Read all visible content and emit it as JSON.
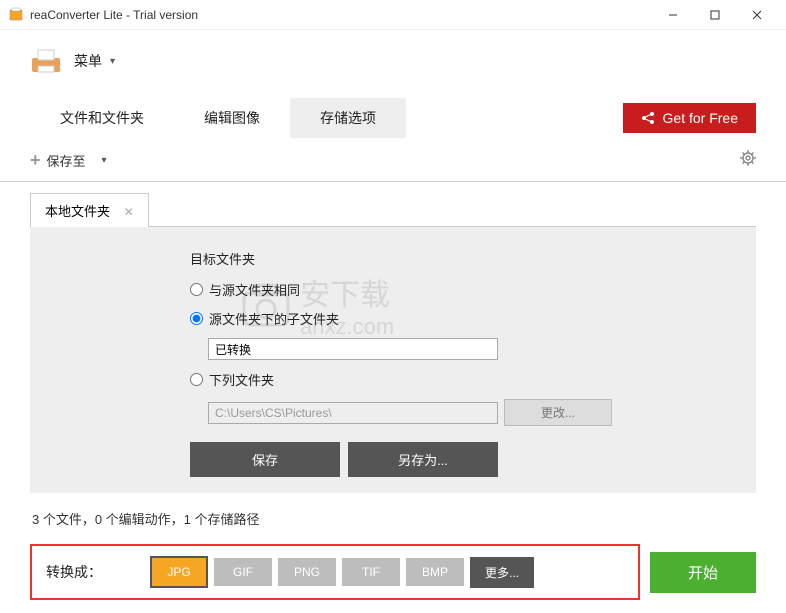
{
  "window": {
    "title": "reaConverter Lite - Trial version"
  },
  "menu": {
    "label": "菜单"
  },
  "tabs": {
    "files": "文件和文件夹",
    "edit": "编辑图像",
    "storage": "存储选项"
  },
  "getfree": "Get for Free",
  "toolbar": {
    "saveto": "保存至"
  },
  "subtab": {
    "label": "本地文件夹"
  },
  "panel": {
    "title": "目标文件夹",
    "opt_same": "与源文件夹相同",
    "opt_sub": "源文件夹下的子文件夹",
    "sub_value": "已转换",
    "opt_below": "下列文件夹",
    "path_value": "C:\\Users\\CS\\Pictures\\",
    "change": "更改...",
    "save": "保存",
    "saveas": "另存为..."
  },
  "status": "3 个文件，0 个编辑动作，1 个存储路径",
  "convert": {
    "label": "转换成：",
    "jpg": "JPG",
    "gif": "GIF",
    "png": "PNG",
    "tif": "TIF",
    "bmp": "BMP",
    "more": "更多..."
  },
  "start": "开始",
  "watermark": {
    "text1": "安下载",
    "text2": "anxz.com"
  }
}
